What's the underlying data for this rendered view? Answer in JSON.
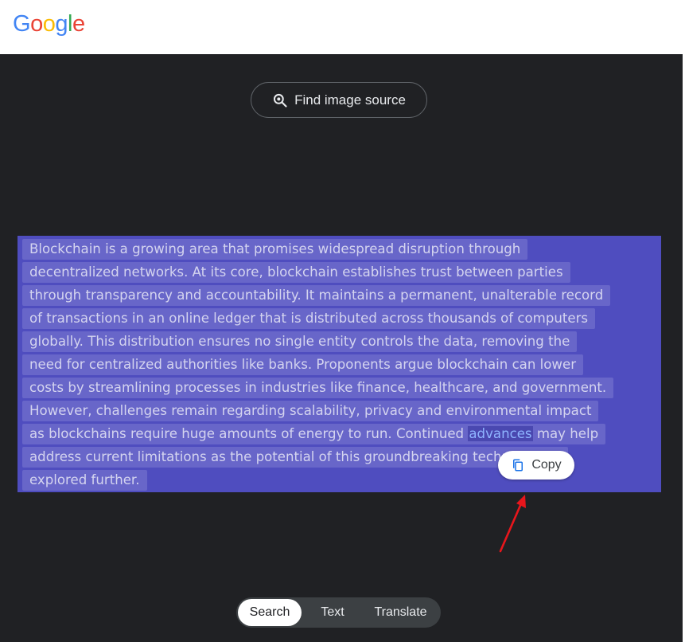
{
  "logo": {
    "letters": [
      "G",
      "o",
      "o",
      "g",
      "l",
      "e"
    ],
    "colors": [
      "#4285F4",
      "#EA4335",
      "#FBBC05",
      "#4285F4",
      "#34A853",
      "#EA4335"
    ]
  },
  "find_source": {
    "label": "Find image source",
    "icon": "lens-search-icon"
  },
  "ocr": {
    "lines": [
      "Blockchain is a growing area that promises widespread disruption through",
      "decentralized networks. At its core, blockchain establishes trust between parties",
      "through transparency and accountability. It maintains a permanent, unalterable record",
      "of transactions in an online ledger that is distributed across thousands of computers",
      "globally. This distribution ensures no single entity controls the data, removing the",
      "need for centralized authorities like banks. Proponents argue blockchain can lower",
      "costs by streamlining processes in industries like finance, healthcare, and government.",
      "However, challenges remain regarding scalability, privacy and environmental impact"
    ],
    "line9_before": "as blockchains require huge amounts of energy to run. Continued ",
    "line9_highlight": "advances",
    "line9_after": " may help",
    "line10": "address current limitations as the potential of this groundbreaking technology is",
    "line11": "explored further."
  },
  "copy": {
    "label": "Copy",
    "icon": "copy-icon"
  },
  "tabs": [
    {
      "label": "Search",
      "active": true
    },
    {
      "label": "Text",
      "active": false
    },
    {
      "label": "Translate",
      "active": false
    }
  ],
  "colors": {
    "viewer_bg": "#202124",
    "selection": "#4f4dbf",
    "arrow": "#e8161c"
  }
}
